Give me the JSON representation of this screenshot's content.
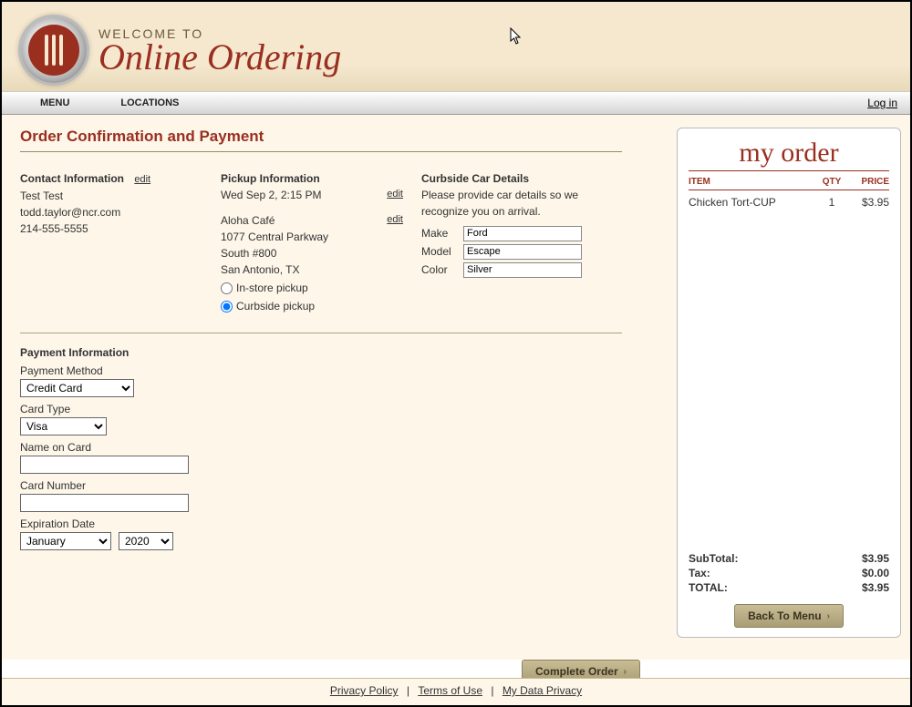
{
  "header": {
    "welcome": "WELCOME TO",
    "title": "Online Ordering"
  },
  "nav": {
    "menu": "MENU",
    "locations": "LOCATIONS",
    "login": "Log in"
  },
  "page_title": "Order Confirmation and Payment",
  "contact": {
    "heading": "Contact Information",
    "edit": "edit",
    "name": "Test Test",
    "email": "todd.taylor@ncr.com",
    "phone": "214-555-5555"
  },
  "pickup": {
    "heading": "Pickup Information",
    "time": "Wed Sep 2, 2:15 PM",
    "edit1": "edit",
    "store": "Aloha Café",
    "addr1": "1077 Central Parkway",
    "addr2": "South #800",
    "city": "San Antonio, TX",
    "edit2": "edit",
    "opt_instore": "In-store pickup",
    "opt_curbside": "Curbside pickup"
  },
  "car": {
    "heading": "Curbside Car Details",
    "instruction": "Please provide car details so we recognize you on arrival.",
    "make_label": "Make",
    "make": "Ford",
    "model_label": "Model",
    "model": "Escape",
    "color_label": "Color",
    "color": "Silver"
  },
  "payment": {
    "heading": "Payment Information",
    "method_label": "Payment Method",
    "method": "Credit Card",
    "cardtype_label": "Card Type",
    "cardtype": "Visa",
    "name_label": "Name on Card",
    "name": "",
    "number_label": "Card Number",
    "number": "",
    "exp_label": "Expiration Date",
    "exp_month": "January",
    "exp_year": "2020"
  },
  "buttons": {
    "complete": "Complete Order",
    "back": "Back To Menu"
  },
  "order": {
    "title": "my order",
    "head_item": "ITEM",
    "head_qty": "QTY",
    "head_price": "PRICE",
    "items": [
      {
        "name": "Chicken Tort-CUP",
        "qty": "1",
        "price": "$3.95"
      }
    ],
    "subtotal_label": "SubTotal:",
    "subtotal": "$3.95",
    "tax_label": "Tax:",
    "tax": "$0.00",
    "total_label": "TOTAL:",
    "total": "$3.95"
  },
  "footer": {
    "privacy": "Privacy Policy",
    "terms": "Terms of Use",
    "mydata": "My Data Privacy"
  }
}
